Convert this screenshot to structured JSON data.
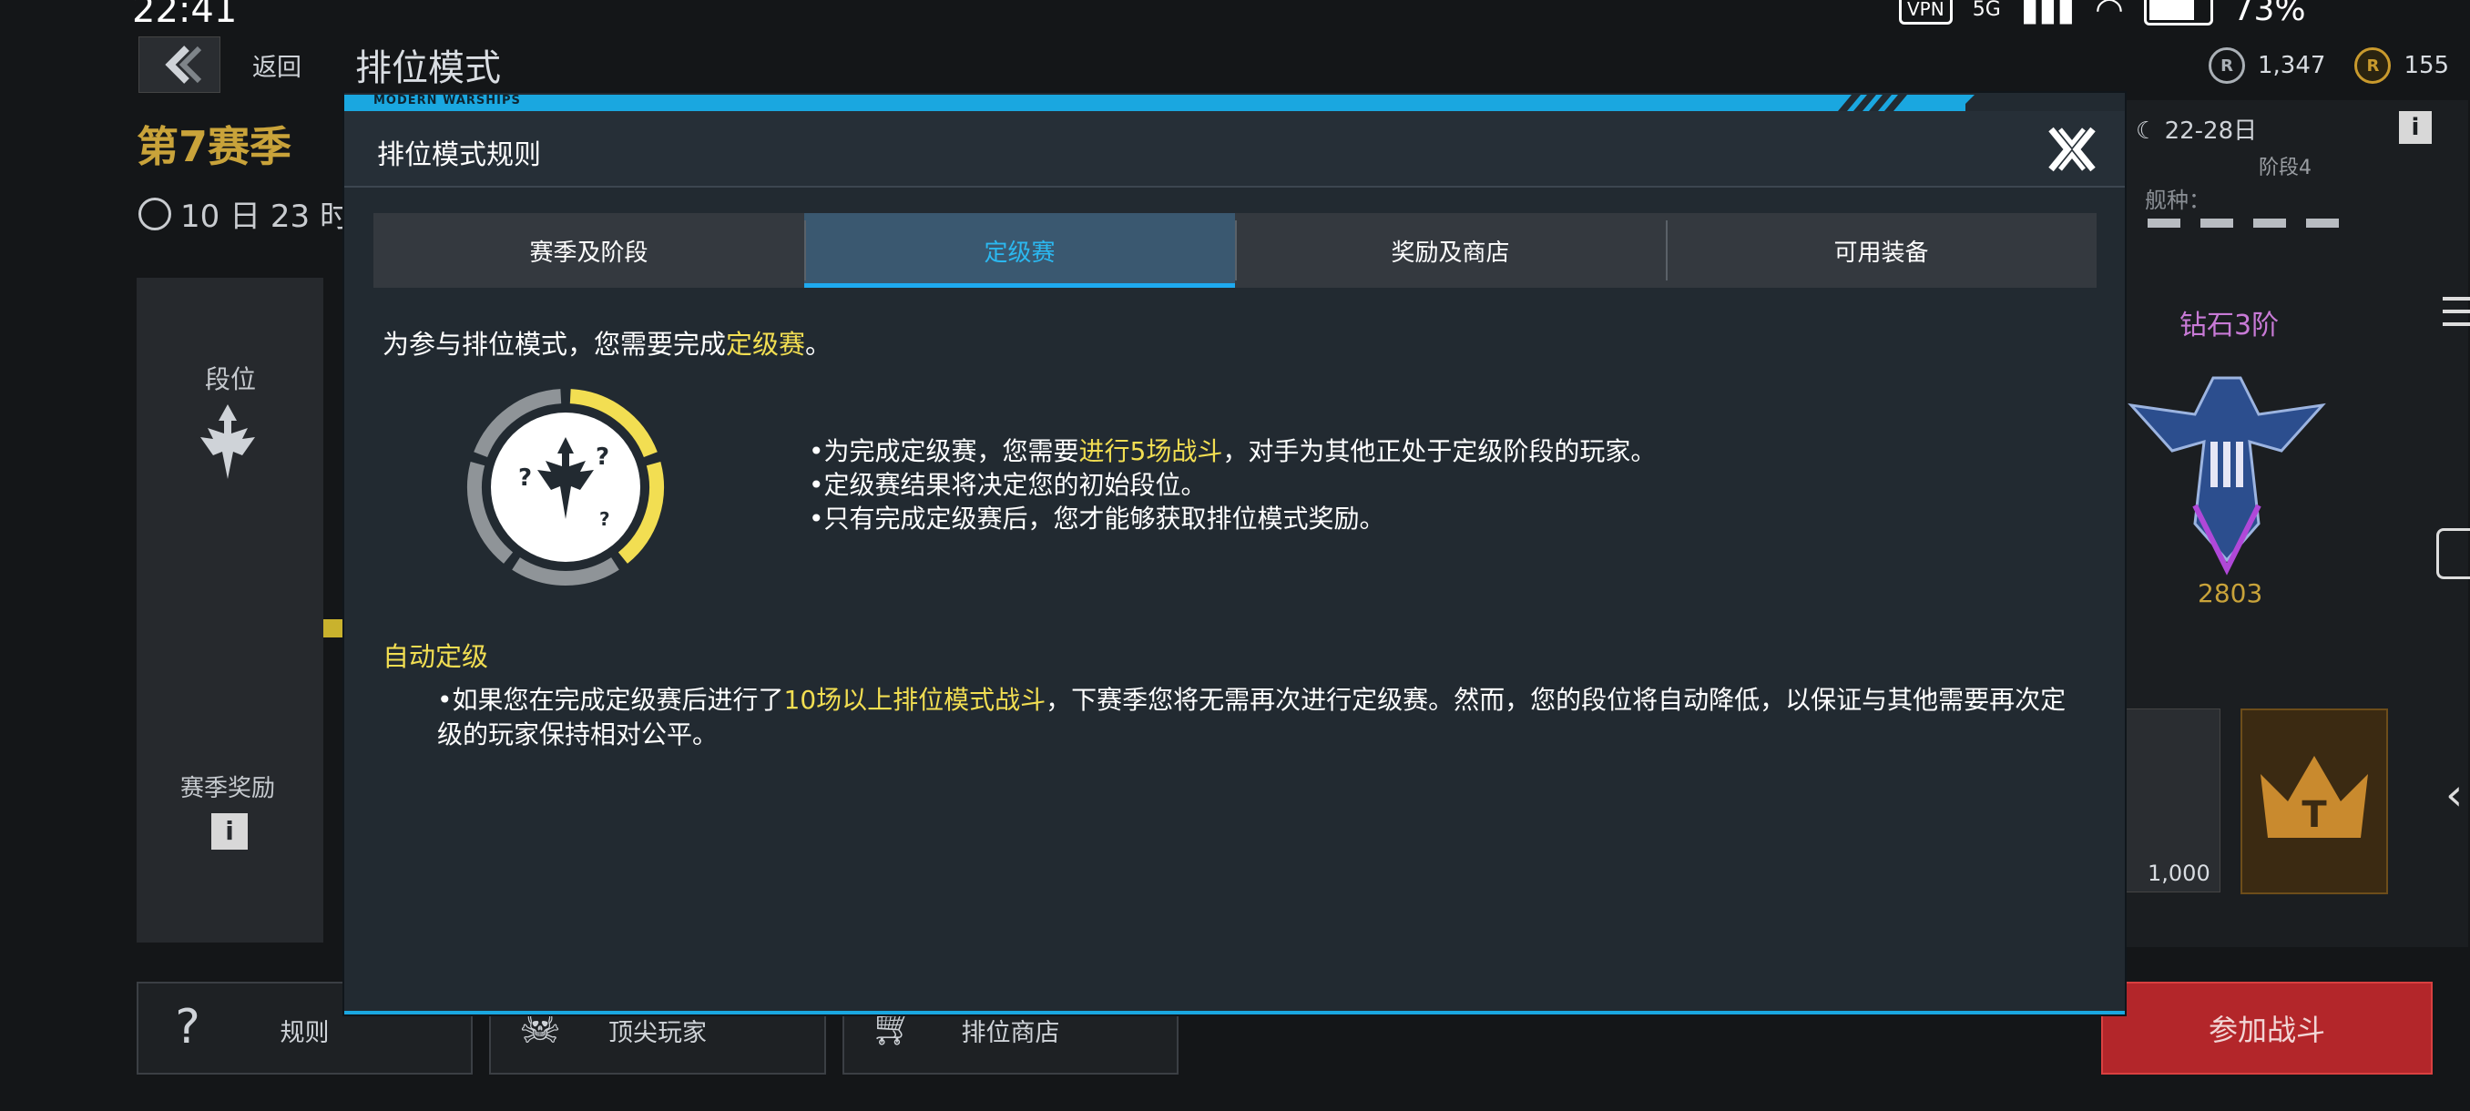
{
  "status_bar": {
    "time": "22:41",
    "vpn": "VPN",
    "network": "5G",
    "battery": "73%"
  },
  "header": {
    "back_label": "返回",
    "title": "排位模式",
    "currency_1": "1,347",
    "currency_2": "155"
  },
  "left_panel": {
    "season": "第7赛季",
    "timer": "10 日 23 时",
    "rank_label": "段位",
    "season_rewards": "赛季奖励"
  },
  "right_panel": {
    "dates": "22-28日",
    "stage": "阶段4",
    "ship_class": "舰种：",
    "rank_name": "钻石3阶",
    "rank_score": "2803",
    "card_amount": "1,000",
    "join_battle": "参加战斗"
  },
  "bottom_bar": {
    "rules": "规则",
    "top_players": "顶尖玩家",
    "ranked_shop": "排位商店"
  },
  "modal": {
    "brand": "MODERN WARSHIPS",
    "title": "排位模式规则",
    "tabs": [
      {
        "label": "赛季及阶段",
        "active": false
      },
      {
        "label": "定级赛",
        "active": true
      },
      {
        "label": "奖励及商店",
        "active": false
      },
      {
        "label": "可用装备",
        "active": false
      }
    ],
    "intro_prefix": "为参与排位模式，您需要完成",
    "intro_highlight": "定级赛",
    "intro_suffix": "。",
    "bullet_1_prefix": "•为完成定级赛，您需要",
    "bullet_1_highlight": "进行5场战斗",
    "bullet_1_suffix": "，对手为其他正处于定级阶段的玩家。",
    "bullet_2": "•定级赛结果将决定您的初始段位。",
    "bullet_3": "•只有完成定级赛后，您才能够获取排位模式奖励。",
    "ring_marks": [
      "?",
      "?",
      "?"
    ],
    "auto_title": "自动定级",
    "auto_prefix": "•如果您在完成定级赛后进行了",
    "auto_highlight": "10场以上排位模式战斗",
    "auto_suffix": "，下赛季您将无需再次进行定级赛。然而，您的段位将自动降低，以保证与其他需要再次定级的玩家保持相对公平。"
  },
  "progress": {
    "placement_matches_done_fraction": 0.4
  },
  "colors": {
    "accent": "#1eaaf0",
    "highlight": "#f2de52",
    "gold": "#c9a33a",
    "battle": "#b3262a"
  }
}
